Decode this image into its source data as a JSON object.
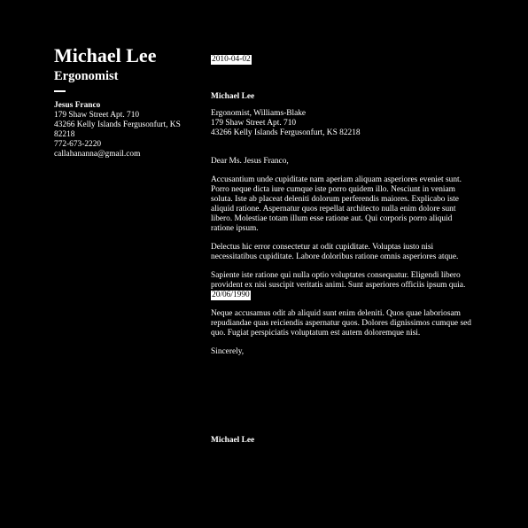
{
  "sender": {
    "name": "Michael Lee",
    "title": "Ergonomist",
    "title_company": "Ergonomist, Williams-Blake",
    "address_line1": "179 Shaw Street Apt. 710",
    "address_line2": "43266 Kelly Islands Fergusonfurt, KS 82218"
  },
  "recipient": {
    "name": "Jesus Franco",
    "address_line1": "179 Shaw Street Apt. 710",
    "address_line2": "43266 Kelly Islands Fergusonfurt, KS 82218",
    "phone": "772-673-2220",
    "email": "callahananna@gmail.com"
  },
  "letter": {
    "date": "2010-04-02",
    "salutation": "Dear Ms. Jesus Franco,",
    "paragraph1": "Accusantium unde cupiditate nam aperiam aliquam asperiores eveniet sunt. Porro neque dicta iure cumque iste porro quidem illo. Nesciunt in veniam soluta. Iste ab placeat deleniti dolorum perferendis maiores. Explicabo iste aliquid ratione. Aspernatur quos repellat architecto nulla enim dolore sunt libero. Molestiae totam illum esse ratione aut. Qui corporis porro aliquid ratione ipsum.",
    "paragraph2": "Delectus hic error consectetur at odit cupiditate. Voluptas iusto nisi necessitatibus cupiditate. Labore doloribus ratione omnis asperiores atque.",
    "paragraph3": "Sapiente iste ratione qui nulla optio voluptates consequatur. Eligendi libero provident ex nisi suscipit veritatis animi. Sunt asperiores officiis ipsum quia.",
    "paragraph3_date": "20/06/1990",
    "paragraph4": "Neque accusamus odit ab aliquid sunt enim deleniti. Quos quae laboriosam repudiandae quas reiciendis aspernatur quos. Dolores dignissimos cumque sed quo. Fugiat perspiciatis voluptatum est autem doloremque nisi.",
    "closing": "Sincerely,",
    "signature": "Michael Lee"
  }
}
